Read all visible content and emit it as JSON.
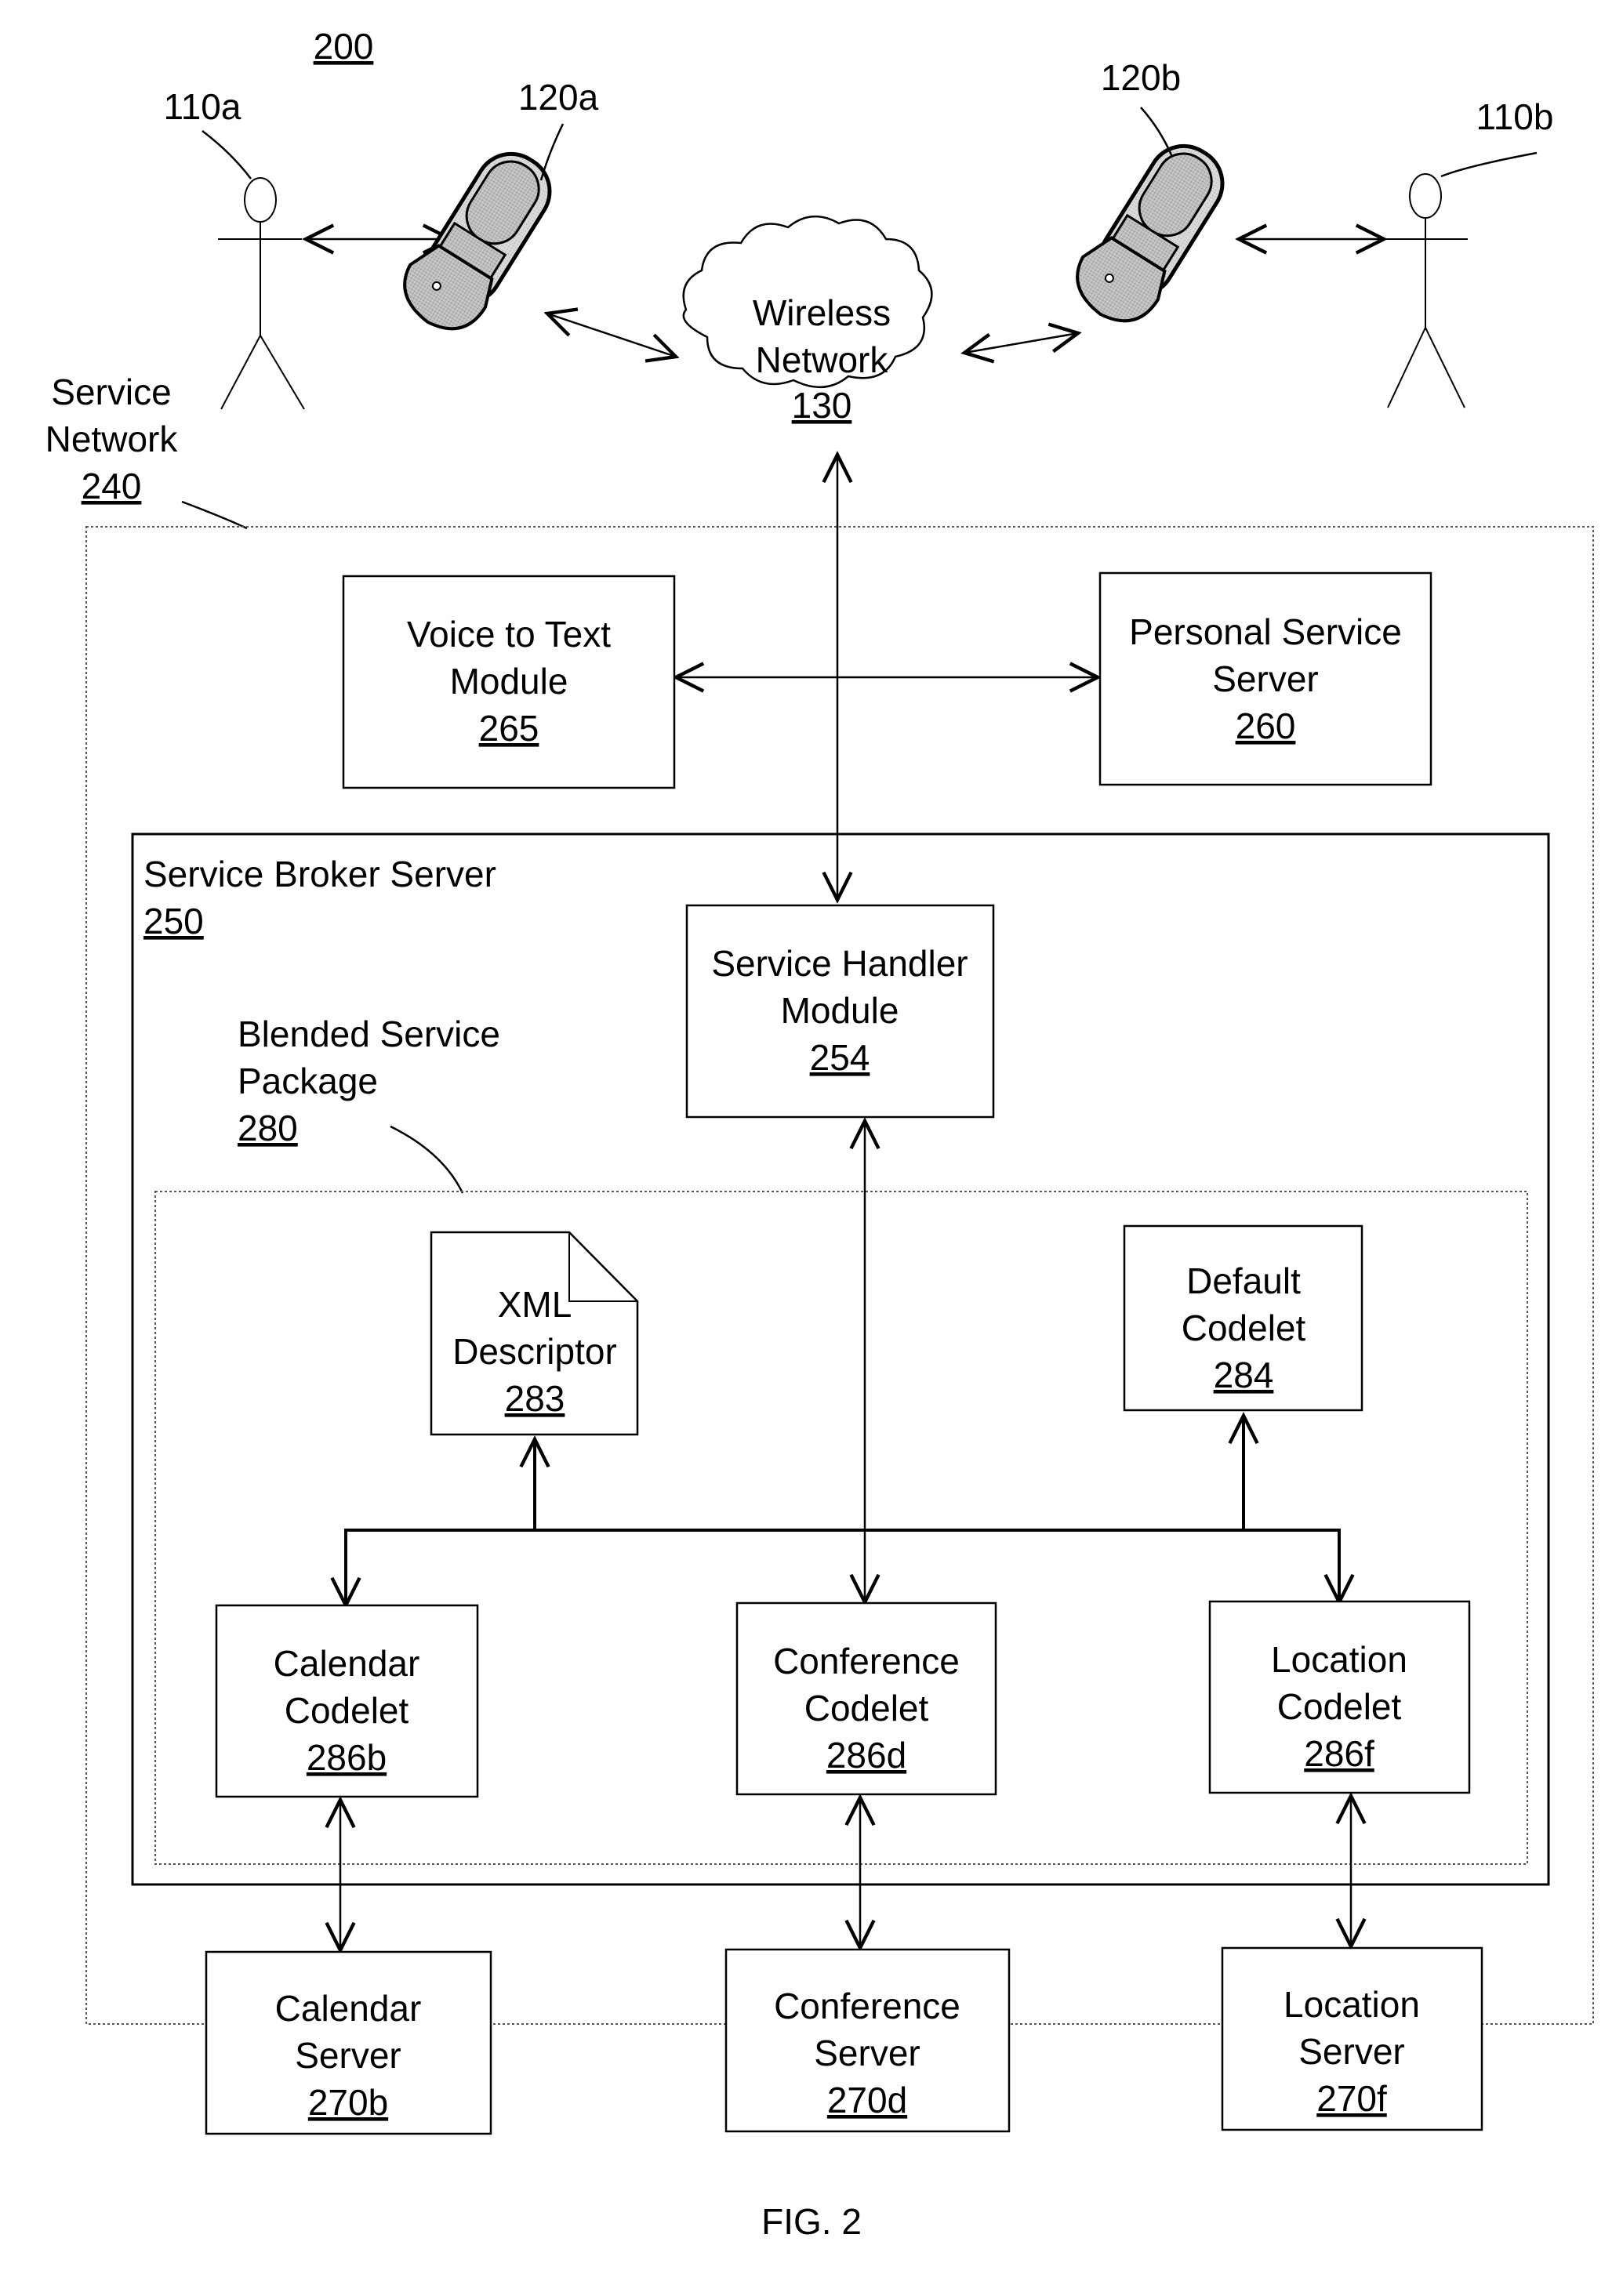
{
  "figure": {
    "ref": "200",
    "caption": "FIG. 2"
  },
  "users": [
    {
      "id": "user-a",
      "ref": "110a"
    },
    {
      "id": "user-b",
      "ref": "110b"
    }
  ],
  "devices": [
    {
      "id": "phone-a",
      "ref": "120a"
    },
    {
      "id": "phone-b",
      "ref": "120b"
    }
  ],
  "wireless_network": {
    "lines": [
      "Wireless",
      "Network"
    ],
    "ref": "130"
  },
  "service_network": {
    "lines": [
      "Service",
      "Network"
    ],
    "ref": "240"
  },
  "voice_to_text": {
    "lines": [
      "Voice to Text",
      "Module"
    ],
    "ref": "265"
  },
  "personal_service_server": {
    "lines": [
      "Personal Service",
      "Server"
    ],
    "ref": "260"
  },
  "service_broker_server": {
    "lines": [
      "Service Broker Server"
    ],
    "ref": "250"
  },
  "service_handler": {
    "lines": [
      "Service Handler",
      "Module"
    ],
    "ref": "254"
  },
  "blended_service_package": {
    "lines": [
      "Blended Service",
      "Package"
    ],
    "ref": "280"
  },
  "xml_descriptor": {
    "lines": [
      "XML",
      "Descriptor"
    ],
    "ref": "283"
  },
  "default_codelet": {
    "lines": [
      "Default",
      "Codelet"
    ],
    "ref": "284"
  },
  "codelets": [
    {
      "lines": [
        "Calendar",
        "Codelet"
      ],
      "ref": "286b"
    },
    {
      "lines": [
        "Conference",
        "Codelet"
      ],
      "ref": "286d"
    },
    {
      "lines": [
        "Location",
        "Codelet"
      ],
      "ref": "286f"
    }
  ],
  "servers": [
    {
      "lines": [
        "Calendar",
        "Server"
      ],
      "ref": "270b"
    },
    {
      "lines": [
        "Conference",
        "Server"
      ],
      "ref": "270d"
    },
    {
      "lines": [
        "Location",
        "Server"
      ],
      "ref": "270f"
    }
  ]
}
